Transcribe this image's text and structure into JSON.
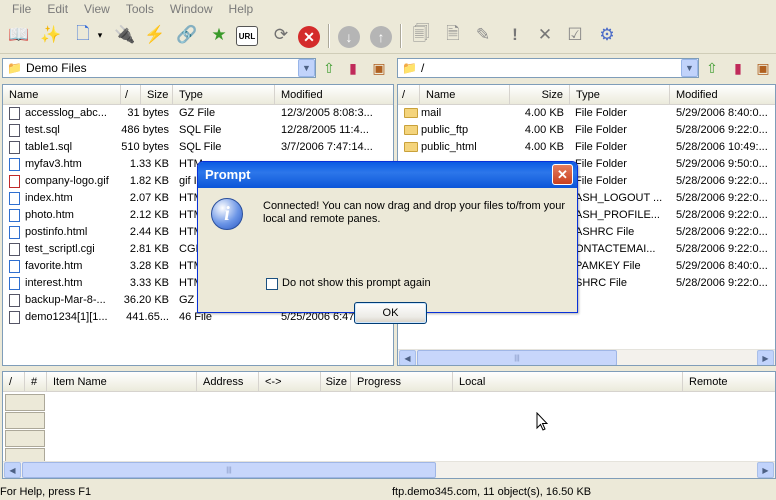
{
  "menu": [
    "File",
    "Edit",
    "View",
    "Tools",
    "Window",
    "Help"
  ],
  "toolbar": {
    "icons": [
      "open-book-icon",
      "magic-wand-icon",
      "new-file-icon",
      "dropdown-arrow-icon",
      "connect-plug-icon",
      "disconnect-icon",
      "reconnect-icon",
      "bookmark-icon",
      "url-icon",
      "refresh-icon",
      "stop-icon",
      "download-icon",
      "upload-icon",
      "properties-icon",
      "rename-icon",
      "edit-icon",
      "alert-icon",
      "delete-icon",
      "check-icon",
      "settings-icon"
    ],
    "url_label": "URL"
  },
  "left_path": {
    "value": "Demo Files"
  },
  "right_path": {
    "value": "/"
  },
  "left_pane": {
    "headers": [
      "Name",
      "/",
      "Size",
      "Type",
      "Modified"
    ],
    "rows": [
      {
        "name": "accesslog_abc...",
        "size": "31 bytes",
        "type": "GZ File",
        "modified": "12/3/2005 8:08:3...",
        "icon": "gz"
      },
      {
        "name": "test.sql",
        "size": "486 bytes",
        "type": "SQL File",
        "modified": "12/28/2005 11:4...",
        "icon": "sql"
      },
      {
        "name": "table1.sql",
        "size": "510 bytes",
        "type": "SQL File",
        "modified": "3/7/2006 7:47:14...",
        "icon": "sql"
      },
      {
        "name": "myfav3.htm",
        "size": "1.33 KB",
        "type": "HTM",
        "modified": "",
        "icon": "htm"
      },
      {
        "name": "company-logo.gif",
        "size": "1.82 KB",
        "type": "gif I",
        "modified": "",
        "icon": "gif"
      },
      {
        "name": "index.htm",
        "size": "2.07 KB",
        "type": "HTM",
        "modified": "",
        "icon": "htm"
      },
      {
        "name": "photo.htm",
        "size": "2.12 KB",
        "type": "HTM",
        "modified": "",
        "icon": "htm"
      },
      {
        "name": "postinfo.html",
        "size": "2.44 KB",
        "type": "HTM",
        "modified": "",
        "icon": "htm"
      },
      {
        "name": "test_scriptl.cgi",
        "size": "2.81 KB",
        "type": "CGI",
        "modified": "",
        "icon": "cgi"
      },
      {
        "name": "favorite.htm",
        "size": "3.28 KB",
        "type": "HTM",
        "modified": "",
        "icon": "htm"
      },
      {
        "name": "interest.htm",
        "size": "3.33 KB",
        "type": "HTM",
        "modified": "",
        "icon": "htm"
      },
      {
        "name": "backup-Mar-8-...",
        "size": "36.20 KB",
        "type": "GZ F",
        "modified": "",
        "icon": "gz"
      },
      {
        "name": "demo1234[1][1...",
        "size": "441.65...",
        "type": "46 File",
        "modified": "5/25/2006 6:47:1...",
        "icon": "file"
      }
    ]
  },
  "right_pane": {
    "headers": [
      "/",
      "Name",
      "Size",
      "Type",
      "Modified"
    ],
    "rows": [
      {
        "name": "mail",
        "size": "4.00 KB",
        "type": "File Folder",
        "modified": "5/29/2006 8:40:0..."
      },
      {
        "name": "public_ftp",
        "size": "4.00 KB",
        "type": "File Folder",
        "modified": "5/28/2006 9:22:0..."
      },
      {
        "name": "public_html",
        "size": "4.00 KB",
        "type": "File Folder",
        "modified": "5/28/2006 10:49:..."
      },
      {
        "name": "",
        "size": "",
        "type": "File Folder",
        "modified": "5/29/2006 9:50:0..."
      },
      {
        "name": "",
        "size": "",
        "type": "File Folder",
        "modified": "5/28/2006 9:22:0..."
      },
      {
        "name": "",
        "size": "",
        "type": "ASH_LOGOUT ...",
        "modified": "5/28/2006 9:22:0..."
      },
      {
        "name": "",
        "size": "",
        "type": "ASH_PROFILE...",
        "modified": "5/28/2006 9:22:0..."
      },
      {
        "name": "",
        "size": "",
        "type": "ASHRC File",
        "modified": "5/28/2006 9:22:0..."
      },
      {
        "name": "",
        "size": "",
        "type": "ONTACTEMAI...",
        "modified": "5/28/2006 9:22:0..."
      },
      {
        "name": "",
        "size": "",
        "type": "PAMKEY File",
        "modified": "5/29/2006 8:40:0..."
      },
      {
        "name": "",
        "size": "",
        "type": "SHRC File",
        "modified": "5/28/2006 9:22:0..."
      }
    ]
  },
  "queue": {
    "headers": [
      "/",
      "#",
      "Item Name",
      "Address",
      "<->",
      "Size",
      "Progress",
      "Local",
      "Remote"
    ]
  },
  "dialog": {
    "title": "Prompt",
    "message": "Connected! You can now drag and drop your files to/from your local and remote panes.",
    "checkbox_label": "Do not show this prompt again",
    "ok_label": "OK"
  },
  "status": {
    "left": "For Help, press F1",
    "right": "ftp.demo345.com, 11 object(s), 16.50 KB"
  },
  "colors": {
    "accent": "#0a5ae3",
    "pane_border": "#7f9db9",
    "folder": "#f4d47c"
  }
}
